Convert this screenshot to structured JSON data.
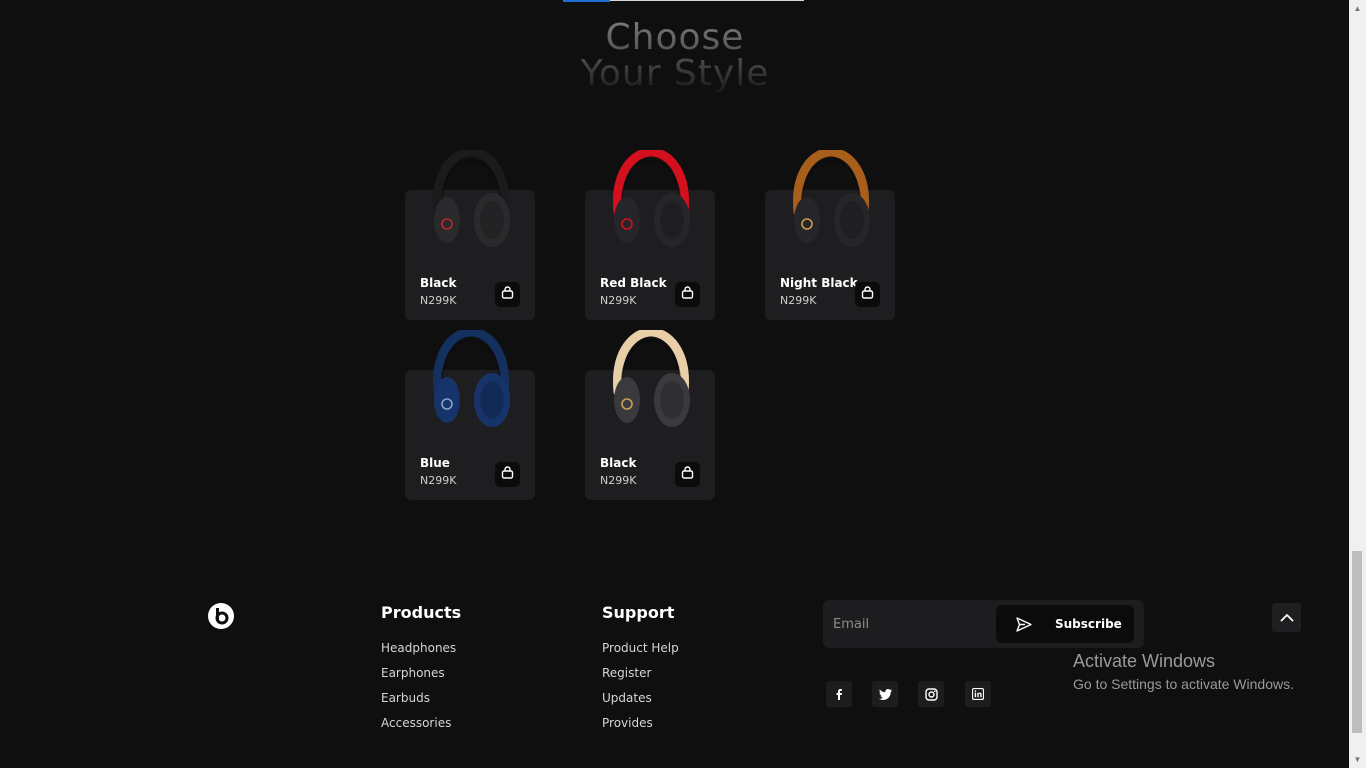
{
  "section": {
    "heading_line1": "Choose",
    "heading_line2": "Your Style"
  },
  "products": [
    {
      "name": "Black",
      "price": "N299K",
      "band_color": "#1b1b1d",
      "cup_color": "#2a2a2c",
      "logo_color": "#b52a2a",
      "icon": "headphones-icon"
    },
    {
      "name": "Red Black",
      "price": "N299K",
      "band_color": "#d4101e",
      "cup_color": "#26262a",
      "logo_color": "#d4101e",
      "icon": "headphones-icon"
    },
    {
      "name": "Night Black",
      "price": "N299K",
      "band_color": "#a85f1c",
      "cup_color": "#26262a",
      "logo_color": "#c89a4a",
      "icon": "headphones-icon"
    },
    {
      "name": "Blue",
      "price": "N299K",
      "band_color": "#13305f",
      "cup_color": "#17346a",
      "logo_color": "#8aa0c8",
      "icon": "headphones-icon"
    },
    {
      "name": "Black",
      "price": "N299K",
      "band_color": "#e9cfa8",
      "cup_color": "#3a3a3e",
      "logo_color": "#c8a050",
      "icon": "headphones-icon"
    }
  ],
  "footer": {
    "logo_icon": "beats-logo-icon",
    "products_title": "Products",
    "products_links": [
      "Headphones",
      "Earphones",
      "Earbuds",
      "Accessories"
    ],
    "support_title": "Support",
    "support_links": [
      "Product Help",
      "Register",
      "Updates",
      "Provides"
    ],
    "email_placeholder": "Email",
    "subscribe_label": "Subscribe",
    "social_icons": [
      "facebook-icon",
      "twitter-icon",
      "instagram-icon",
      "linkedin-icon"
    ]
  },
  "windows_notice": {
    "title": "Activate Windows",
    "subtitle": "Go to Settings to activate Windows."
  },
  "colors": {
    "background": "#0f0f10",
    "card": "#1e1e20",
    "accent": "#1f6ed4"
  }
}
